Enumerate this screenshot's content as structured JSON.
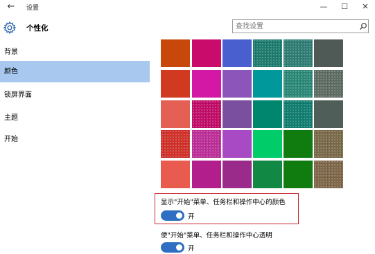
{
  "window": {
    "title": "设置",
    "back_glyph": "←",
    "minimize_glyph": "—",
    "maximize_glyph": "☐",
    "close_glyph": "✕"
  },
  "header": {
    "icon": "gear-icon",
    "title": "个性化"
  },
  "search": {
    "placeholder": "查找设置",
    "icon": "search-icon"
  },
  "sidebar": {
    "items": [
      {
        "label": "背景",
        "selected": false
      },
      {
        "label": "颜色",
        "selected": true
      },
      {
        "label": "锁屏界面",
        "selected": false
      },
      {
        "label": "主题",
        "selected": false
      },
      {
        "label": "开始",
        "selected": false
      }
    ],
    "selected_color": "#a8c8ef"
  },
  "color_grid": {
    "rows": [
      [
        "#c8480b",
        "#c90b6b",
        "#4a5fcf",
        "#1f7d70",
        "#2f7f76",
        "#4f5a57"
      ],
      [
        "#d13a21",
        "#d418a6",
        "#8b55b9",
        "#00989b",
        "#2b8a78",
        "#5f6e64"
      ],
      [
        "#e45f54",
        "#c40d6a",
        "#7b4fa0",
        "#00866e",
        "#117f71",
        "#4f5e58"
      ],
      [
        "#d4322b",
        "#bf2f9a",
        "#a84ac4",
        "#00cc6a",
        "#107c10",
        "#7c6b4b"
      ],
      [
        "#e95b4f",
        "#b21f8c",
        "#9a2b8b",
        "#118944",
        "#107c10",
        "#80684a"
      ]
    ]
  },
  "settings": {
    "show_color": {
      "label": "显示\"开始\"菜单、任务栏和操作中心的颜色",
      "state": "开",
      "on": true
    },
    "transparency": {
      "label": "使\"开始\"菜单、任务栏和操作中心透明",
      "state": "开",
      "on": true
    },
    "highlight_color": "#c8282e",
    "toggle_color": "#2e6fc4"
  }
}
